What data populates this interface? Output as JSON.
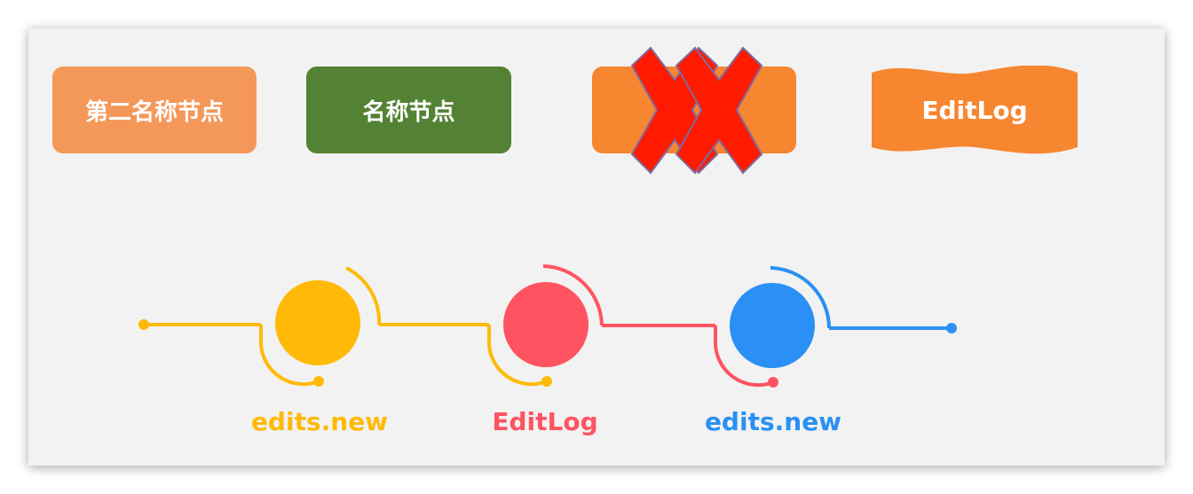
{
  "colors": {
    "slide_bg": "#f2f2f2",
    "box_light_orange": "#f4985a",
    "box_green": "#548235",
    "box_orange": "#f78630",
    "cross_red": "#ff1a00",
    "cross_outline": "#7f6aa0",
    "yellow": "#ffba08",
    "red": "#ff5361",
    "blue": "#2a90f5"
  },
  "top_boxes": [
    {
      "label": "第二名称节点",
      "color": "#f4985a"
    },
    {
      "label": "名称节点",
      "color": "#548235"
    },
    {
      "label": "",
      "color": "#f78630",
      "crossed": true
    },
    {
      "label": "EditLog",
      "color": "#f78630",
      "shape": "wave"
    }
  ],
  "timeline": [
    {
      "label": "edits.new",
      "color": "#ffba08"
    },
    {
      "label": "EditLog",
      "color": "#ff5361"
    },
    {
      "label": "edits.new",
      "color": "#2a90f5"
    }
  ],
  "icons": {
    "cross": "red-x-icon"
  }
}
